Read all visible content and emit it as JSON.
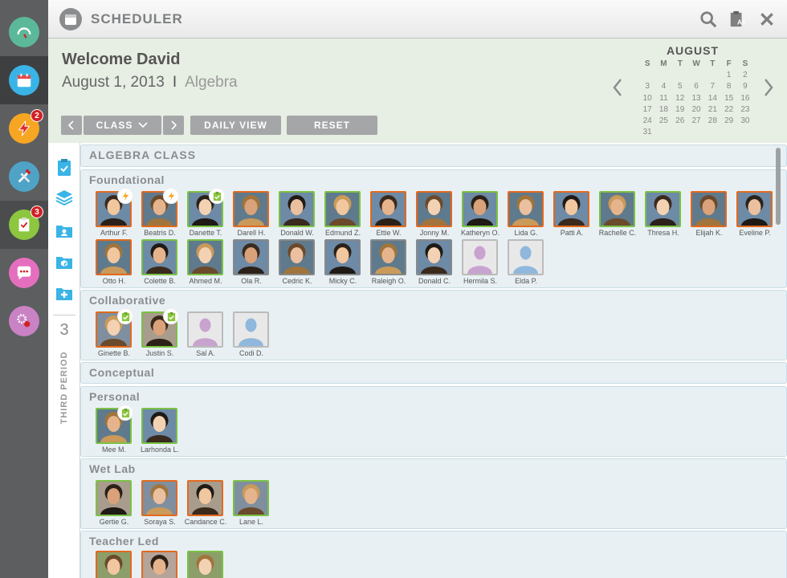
{
  "app": {
    "title": "SCHEDULER"
  },
  "nav": {
    "items": [
      {
        "name": "dashboard",
        "icon": "gauge-icon",
        "color": "#5bb99a"
      },
      {
        "name": "scheduler",
        "icon": "calendar-icon",
        "color": "#3ab4e6"
      },
      {
        "name": "alerts",
        "icon": "lightning-icon",
        "color": "#f6a623",
        "badge": "2"
      },
      {
        "name": "tools",
        "icon": "tools-icon",
        "color": "#4fa3c7"
      },
      {
        "name": "assignments",
        "icon": "clipboard-icon",
        "color": "#8dc63f",
        "badge": "3"
      },
      {
        "name": "messages",
        "icon": "chat-icon",
        "color": "#e56fbf"
      },
      {
        "name": "settings",
        "icon": "gears-icon",
        "color": "#c982c3"
      }
    ]
  },
  "header": {
    "welcome": "Welcome David",
    "date": "August 1, 2013",
    "separator": "I",
    "subject": "Algebra",
    "class_label": "CLASS",
    "daily_view_label": "DAILY VIEW",
    "reset_label": "RESET"
  },
  "calendar": {
    "month": "AUGUST",
    "weekdays": [
      "S",
      "M",
      "T",
      "W",
      "T",
      "F",
      "S"
    ],
    "weeks": [
      [
        "",
        "",
        "",
        "",
        "",
        "1",
        "2"
      ],
      [
        "3",
        "4",
        "5",
        "6",
        "7",
        "8",
        "9"
      ],
      [
        "10",
        "11",
        "12",
        "13",
        "14",
        "15",
        "16"
      ],
      [
        "17",
        "18",
        "19",
        "20",
        "21",
        "22",
        "23"
      ],
      [
        "24",
        "25",
        "26",
        "27",
        "28",
        "29",
        "30"
      ],
      [
        "31",
        "",
        "",
        "",
        "",
        "",
        ""
      ]
    ]
  },
  "sidebar": {
    "period_number": "3",
    "period_label": "THIRD PERIOD"
  },
  "class_title": "ALGEBRA CLASS",
  "colors": {
    "orange": "#e2691e",
    "green": "#7bc143",
    "gray": "#888888"
  },
  "groups": [
    {
      "title": "Foundational",
      "students": [
        {
          "name": "Arthur F.",
          "border": "orange",
          "badge": "lightning"
        },
        {
          "name": "Beatris D.",
          "border": "orange",
          "badge": "lightning"
        },
        {
          "name": "Danette T.",
          "border": "green",
          "badge": "clipboard"
        },
        {
          "name": "Darell H.",
          "border": "orange"
        },
        {
          "name": "Donald W.",
          "border": "green"
        },
        {
          "name": "Edmund Z.",
          "border": "green"
        },
        {
          "name": "Ettie W.",
          "border": "orange"
        },
        {
          "name": "Jonny M.",
          "border": "orange"
        },
        {
          "name": "Katheryn O.",
          "border": "green"
        },
        {
          "name": "Lida G.",
          "border": "orange"
        },
        {
          "name": "Patti A.",
          "border": "orange"
        },
        {
          "name": "Rachelle C.",
          "border": "green"
        },
        {
          "name": "Thresa H.",
          "border": "green"
        },
        {
          "name": "Elijah K.",
          "border": "orange"
        },
        {
          "name": "Eveline P.",
          "border": "orange"
        },
        {
          "name": "Otto H.",
          "border": "orange"
        },
        {
          "name": "Colette B.",
          "border": "green"
        },
        {
          "name": "Ahmed M.",
          "border": "green"
        },
        {
          "name": "Ola R.",
          "border": "gray"
        },
        {
          "name": "Cedric K.",
          "border": "gray"
        },
        {
          "name": "Micky C.",
          "border": "gray"
        },
        {
          "name": "Raleigh O.",
          "border": "gray"
        },
        {
          "name": "Donald C.",
          "border": "gray"
        },
        {
          "name": "Hermila S.",
          "border": "plain",
          "placeholder": "female"
        },
        {
          "name": "Elda P.",
          "border": "plain",
          "placeholder": "male"
        }
      ]
    },
    {
      "title": "Collaborative",
      "students": [
        {
          "name": "Ginette B.",
          "border": "orange",
          "badge": "clipboard"
        },
        {
          "name": "Justin S.",
          "border": "green",
          "badge": "clipboard"
        },
        {
          "name": "Sal A.",
          "border": "plain",
          "placeholder": "female"
        },
        {
          "name": "Codi D.",
          "border": "plain",
          "placeholder": "male"
        }
      ]
    },
    {
      "title": "Conceptual",
      "students": []
    },
    {
      "title": "Personal",
      "students": [
        {
          "name": "Mee M.",
          "border": "green",
          "badge": "clipboard"
        },
        {
          "name": "Larhonda L.",
          "border": "green"
        }
      ]
    },
    {
      "title": "Wet Lab",
      "students": [
        {
          "name": "Gertie G.",
          "border": "green"
        },
        {
          "name": "Soraya S.",
          "border": "orange"
        },
        {
          "name": "Candance C.",
          "border": "orange"
        },
        {
          "name": "Lane L.",
          "border": "green"
        }
      ]
    },
    {
      "title": "Teacher Led",
      "students": [
        {
          "name": "",
          "border": "orange"
        },
        {
          "name": "",
          "border": "orange"
        },
        {
          "name": "",
          "border": "green"
        }
      ]
    }
  ]
}
